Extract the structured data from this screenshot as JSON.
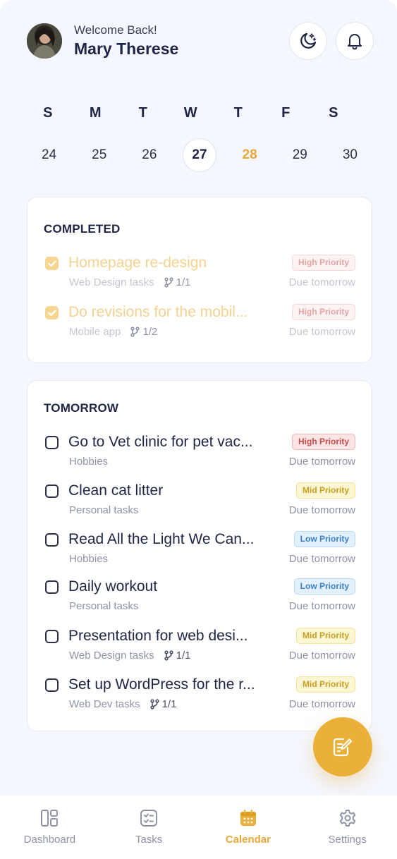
{
  "header": {
    "welcome": "Welcome Back!",
    "user_name": "Mary Therese",
    "avatar_icon": "user-avatar",
    "theme_button_icon": "moon-stars-icon",
    "notification_button_icon": "bell-icon"
  },
  "calendar": {
    "weekdays": [
      "S",
      "M",
      "T",
      "W",
      "T",
      "F",
      "S"
    ],
    "dates": [
      "24",
      "25",
      "26",
      "27",
      "28",
      "29",
      "30"
    ],
    "selected_date": "27",
    "today_date": "28",
    "accent_color": "#e9a93a"
  },
  "completed": {
    "title": "COMPLETED",
    "tasks": [
      {
        "title": "Homepage re-design",
        "category": "Web Design tasks",
        "subtasks": "1/1",
        "priority": "High Priority",
        "due": "Due tomorrow"
      },
      {
        "title": "Do revisions for the mobil...",
        "category": "Mobile app",
        "subtasks": "1/2",
        "priority": "High Priority",
        "due": "Due tomorrow"
      }
    ]
  },
  "tomorrow": {
    "title": "TOMORROW",
    "tasks": [
      {
        "title": "Go to Vet clinic for pet vac...",
        "category": "Hobbies",
        "priority": "High Priority",
        "due": "Due tomorrow"
      },
      {
        "title": "Clean cat litter",
        "category": "Personal tasks",
        "priority": "Mid Priority",
        "due": "Due tomorrow"
      },
      {
        "title": "Read All the Light We Can...",
        "category": "Hobbies",
        "priority": "Low Priority",
        "due": "Due tomorrow"
      },
      {
        "title": "Daily workout",
        "category": "Personal tasks",
        "priority": "Low Priority",
        "due": "Due tomorrow"
      },
      {
        "title": "Presentation for web desi...",
        "category": "Web Design tasks",
        "subtasks": "1/1",
        "priority": "Mid Priority",
        "due": "Due tomorrow"
      },
      {
        "title": "Set up WordPress for the r...",
        "category": "Web Dev tasks",
        "subtasks": "1/1",
        "priority": "Mid Priority",
        "due": "Due tomorrow"
      }
    ]
  },
  "fab": {
    "icon": "edit-note-icon",
    "color": "#ebb039"
  },
  "nav": {
    "items": [
      {
        "label": "Dashboard",
        "icon": "dashboard-icon"
      },
      {
        "label": "Tasks",
        "icon": "tasks-icon"
      },
      {
        "label": "Calendar",
        "icon": "calendar-icon",
        "active": true
      },
      {
        "label": "Settings",
        "icon": "gear-icon"
      }
    ]
  }
}
